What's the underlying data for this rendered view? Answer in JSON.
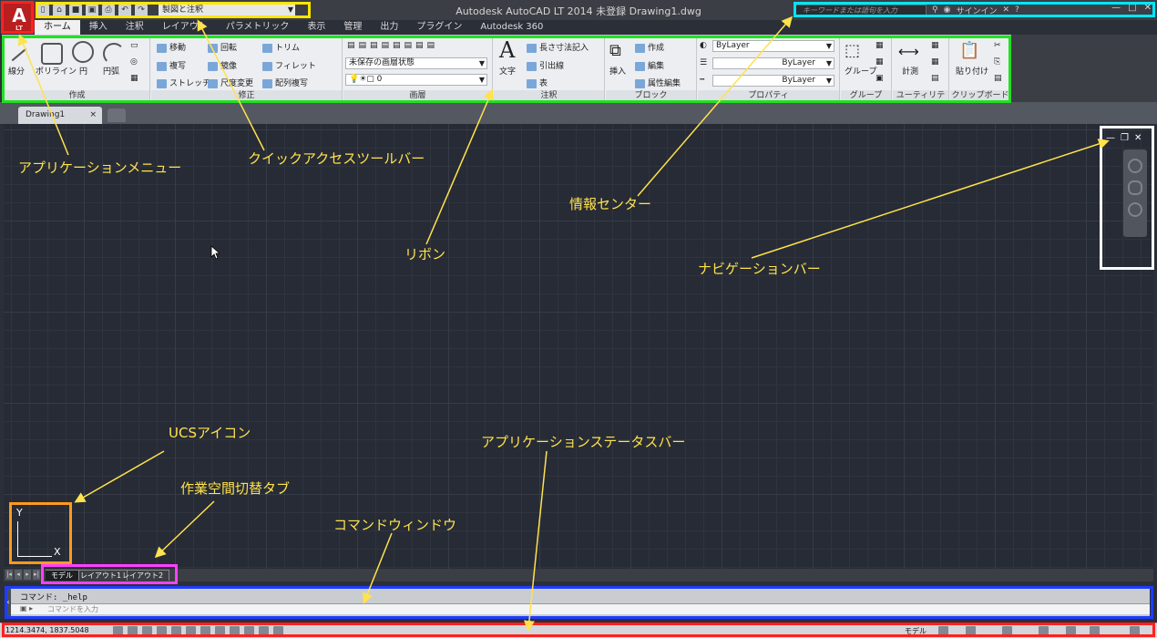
{
  "window": {
    "app_title": "Autodesk AutoCAD LT 2014  未登録  Drawing1.dwg",
    "search_placeholder": "キーワードまたは語句を入力",
    "sign_in": "サインイン",
    "app_button_sub": "LT"
  },
  "qat": {
    "workspace": "製図と注釈"
  },
  "tabs": [
    "ホーム",
    "挿入",
    "注釈",
    "レイアウト",
    "パラメトリック",
    "表示",
    "管理",
    "出力",
    "プラグイン",
    "Autodesk 360"
  ],
  "ribbon": {
    "draw": {
      "title": "作成",
      "line": "線分",
      "polyline": "ポリライン",
      "circle": "円",
      "arc": "円弧"
    },
    "modify": {
      "title": "修正",
      "move": "移動",
      "rotate": "回転",
      "trim": "トリム",
      "copy": "複写",
      "mirror": "鏡像",
      "fillet": "フィレット",
      "stretch": "ストレッチ",
      "scale": "尺度変更",
      "array": "配列複写"
    },
    "layers": {
      "title": "画層",
      "state": "未保存の画層状態",
      "layer": "0"
    },
    "annotation": {
      "title": "注釈",
      "text": "文字",
      "dimension": "長さ寸法記入",
      "leader": "引出線",
      "table": "表"
    },
    "block": {
      "title": "ブロック",
      "insert": "挿入",
      "create": "作成",
      "edit": "編集",
      "attr": "属性編集"
    },
    "properties": {
      "title": "プロパティ",
      "color": "ByLayer",
      "lineweight": "ByLayer",
      "linetype": "ByLayer"
    },
    "groups": {
      "title": "グループ",
      "group": "グループ"
    },
    "utilities": {
      "title": "ユーティリティ",
      "measure": "計測"
    },
    "clipboard": {
      "title": "クリップボード",
      "paste": "貼り付け"
    }
  },
  "file_tab": {
    "name": "Drawing1"
  },
  "ucs": {
    "y": "Y",
    "x": "X"
  },
  "layout_tabs": [
    "モデル",
    "レイアウト1",
    "レイアウト2"
  ],
  "command": {
    "history": "コマンド:  _help",
    "placeholder": "コマンドを入力"
  },
  "status": {
    "coords": "1214.3474, 1837.5048",
    "model": "モデル"
  },
  "annotations": {
    "app_menu": "アプリケーションメニュー",
    "qat": "クイックアクセスツールバー",
    "infocenter": "情報センター",
    "ribbon": "リボン",
    "navbar": "ナビゲーションバー",
    "ucs": "UCSアイコン",
    "workspace_tabs": "作業空間切替タブ",
    "statusbar": "アプリケーションステータスバー",
    "command_window": "コマンドウィンドウ"
  },
  "annotation_colors": {
    "app_menu": "#ff2020",
    "qat": "#ffe600",
    "infocenter": "#00e5ff",
    "ribbon": "#22e022",
    "navbar": "#ffffff",
    "ucs": "#ff9a1f",
    "layout_tabs": "#ff40ff",
    "command": "#1e3cff",
    "status": "#ff2020"
  }
}
